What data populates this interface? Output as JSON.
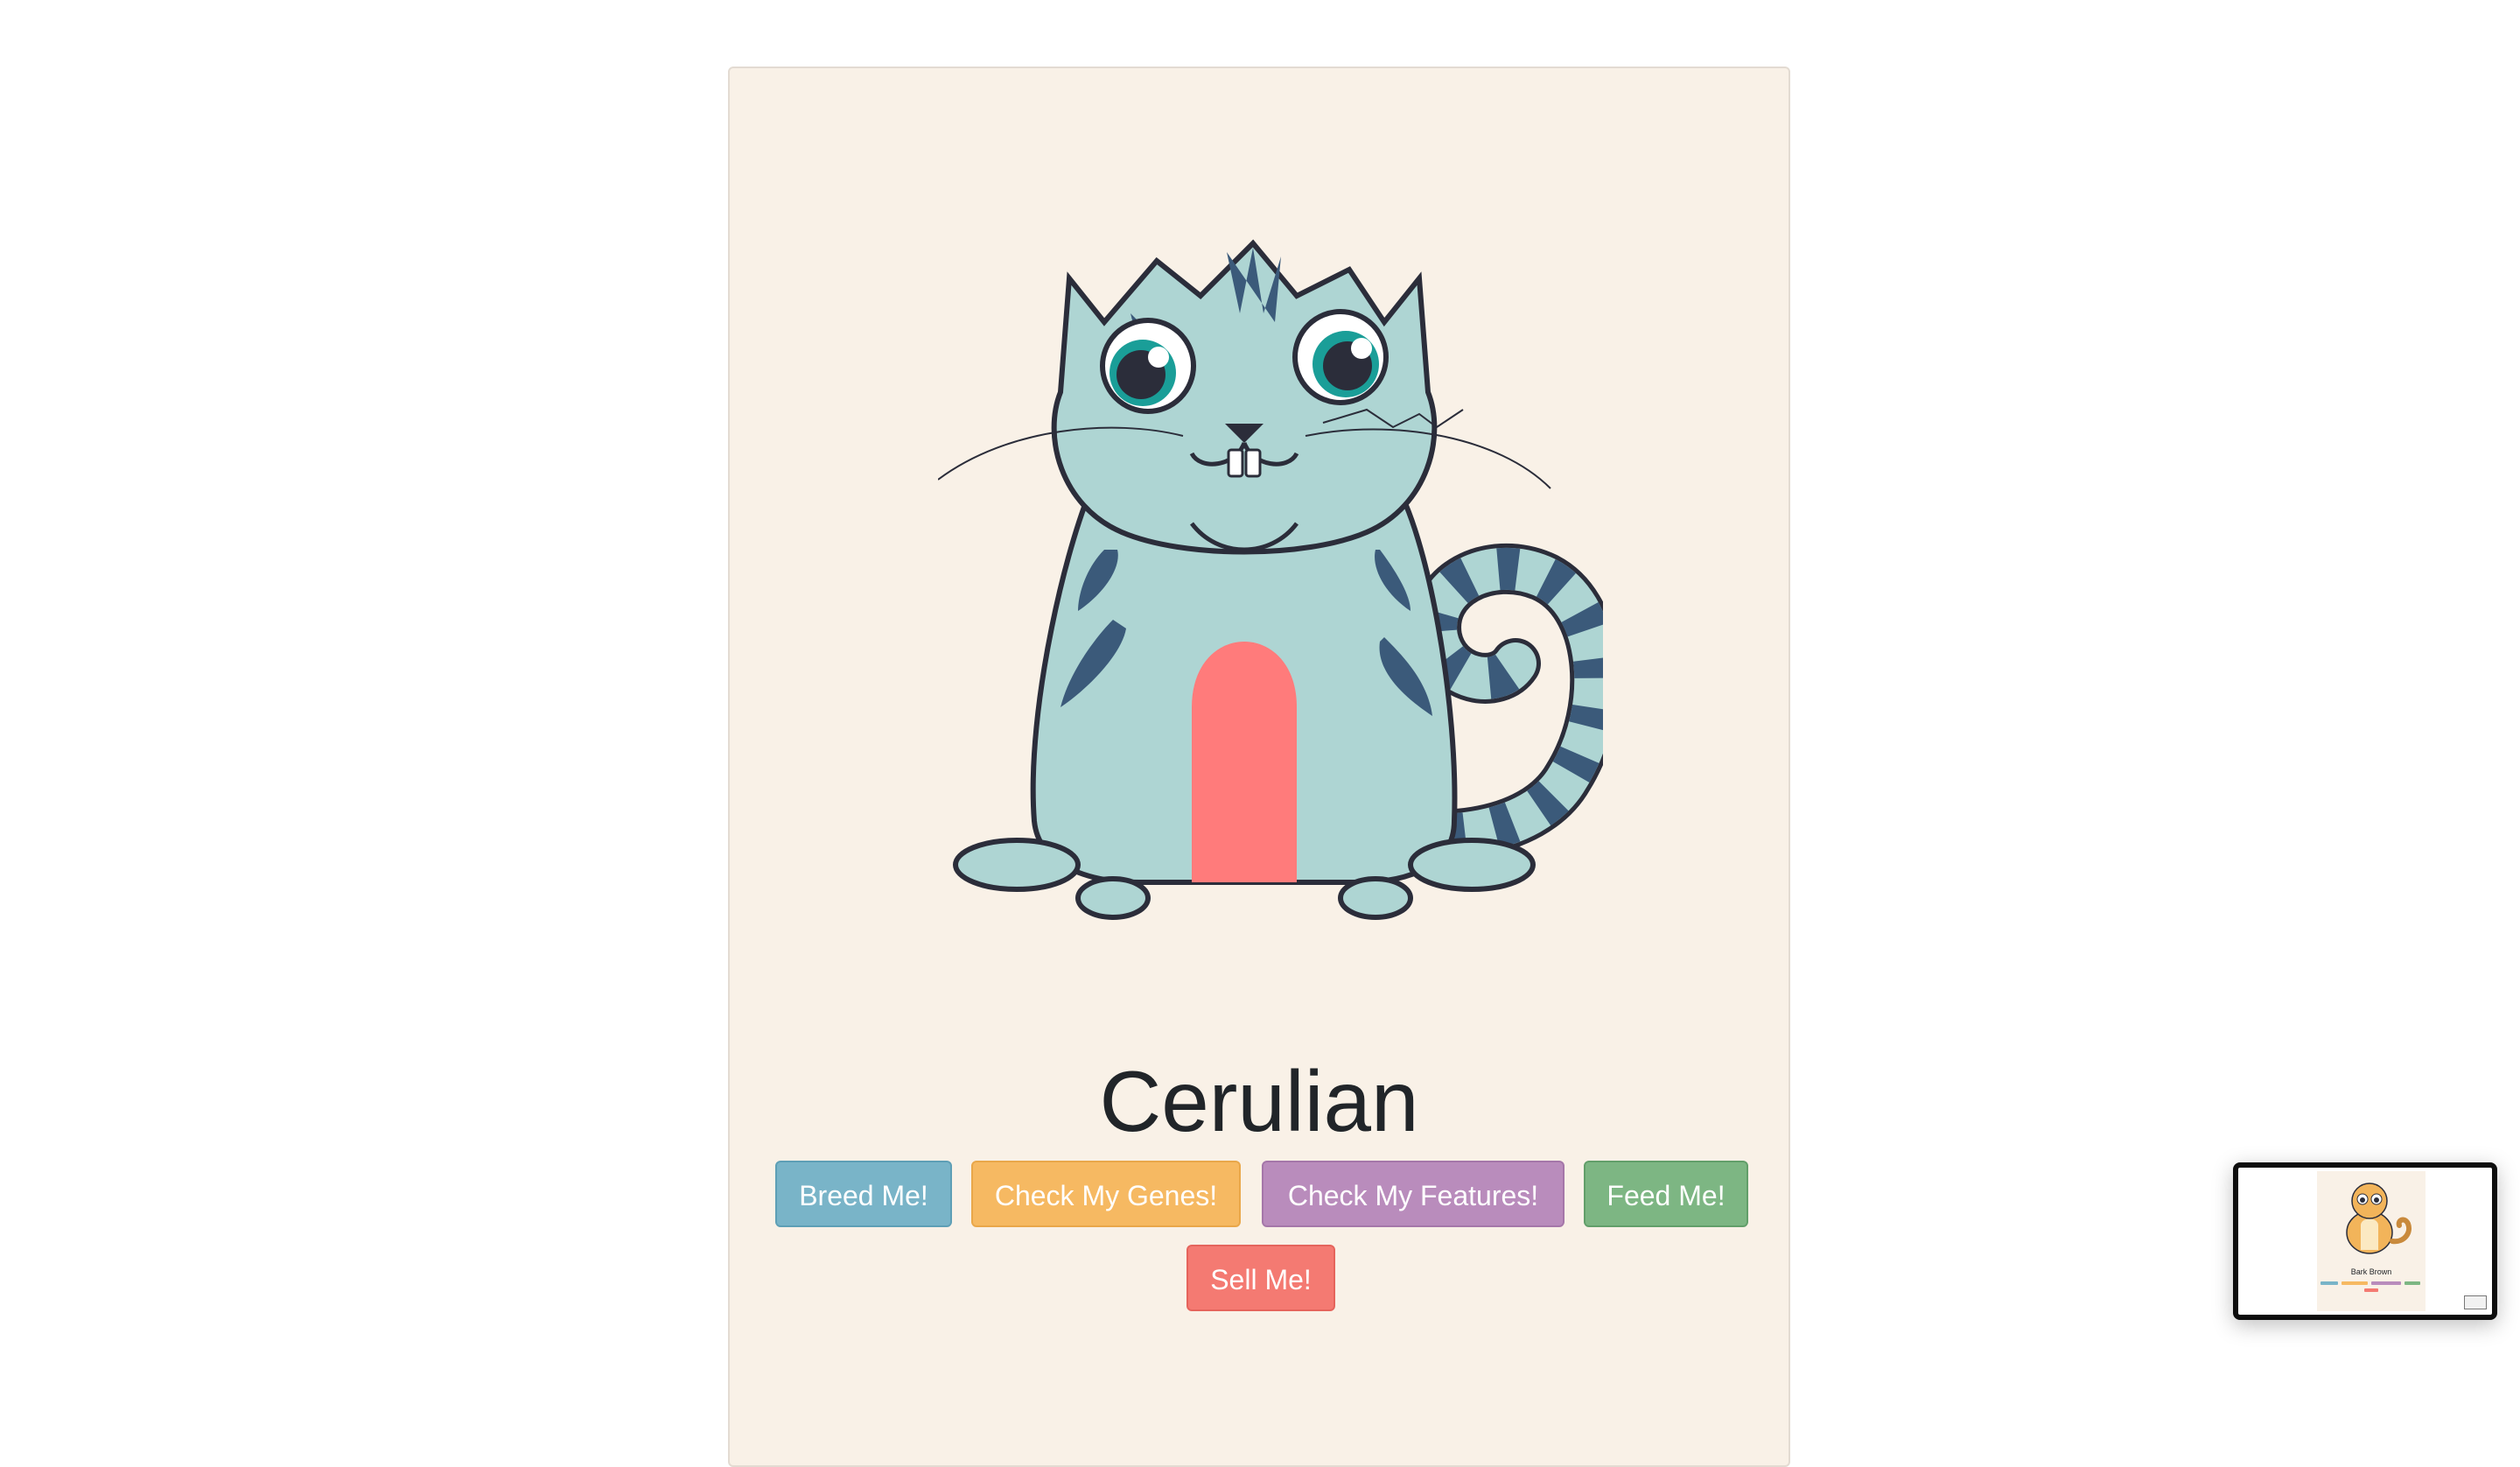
{
  "kitty": {
    "name": "Cerulian",
    "colors": {
      "body": "#aed5d3",
      "pattern": "#3b5a7a",
      "belly": "#ff7b7b",
      "eye_iris": "#1a9e98",
      "outline": "#2b2d3a"
    }
  },
  "buttons": {
    "breed": "Breed Me!",
    "genes": "Check My Genes!",
    "features": "Check My Features!",
    "feed": "Feed Me!",
    "sell": "Sell Me!"
  },
  "button_colors": {
    "breed": "#79b4c8",
    "genes": "#f6b962",
    "features": "#b98cbc",
    "feed": "#7db683",
    "sell": "#f47a72"
  },
  "pip_preview": {
    "name": "Bark Brown",
    "icon": "picture-in-picture-icon"
  }
}
